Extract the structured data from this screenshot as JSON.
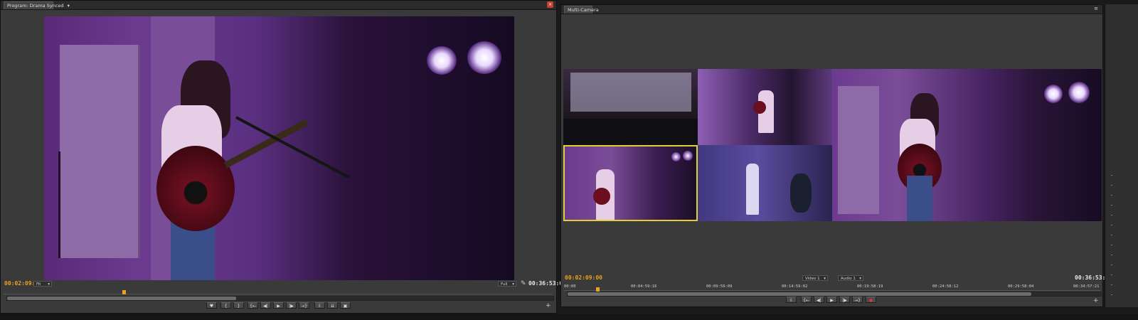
{
  "program_monitor": {
    "tab_label": "Program: Drama Synced",
    "current_timecode": "00:02:09:00",
    "fit_label": "Fit",
    "quality_label": "Full",
    "duration_timecode": "00:36:53:07",
    "playhead_position": 0.2
  },
  "multicam_monitor": {
    "tab_label": "Multi-Camera",
    "current_timecode": "00:02:09:00",
    "duration_timecode": "00:36:53:07",
    "video_track": "Video 1",
    "audio_track": "Audio 1",
    "ruler_labels": [
      "00:00",
      "00:04:59:16",
      "00:09:59:09",
      "00:14:59:02",
      "00:19:58:19",
      "00:24:58:12",
      "00:29:58:04",
      "00:34:57:21"
    ],
    "playhead_position": 0.06
  },
  "transport_glyphs": {
    "marker": "♥",
    "in": "{",
    "out": "}",
    "goto_in": "{←",
    "step_back": "◀|",
    "play": "▶",
    "step_fwd": "|▶",
    "goto_out": "→}",
    "insert": "⇩",
    "overwrite": "⇊",
    "export": "▣",
    "plus": "+",
    "record": "●"
  },
  "colors": {
    "timecode": "#e8a21b",
    "selected_camera": "#e2cf35",
    "stage_light": "#8a3fd0"
  }
}
